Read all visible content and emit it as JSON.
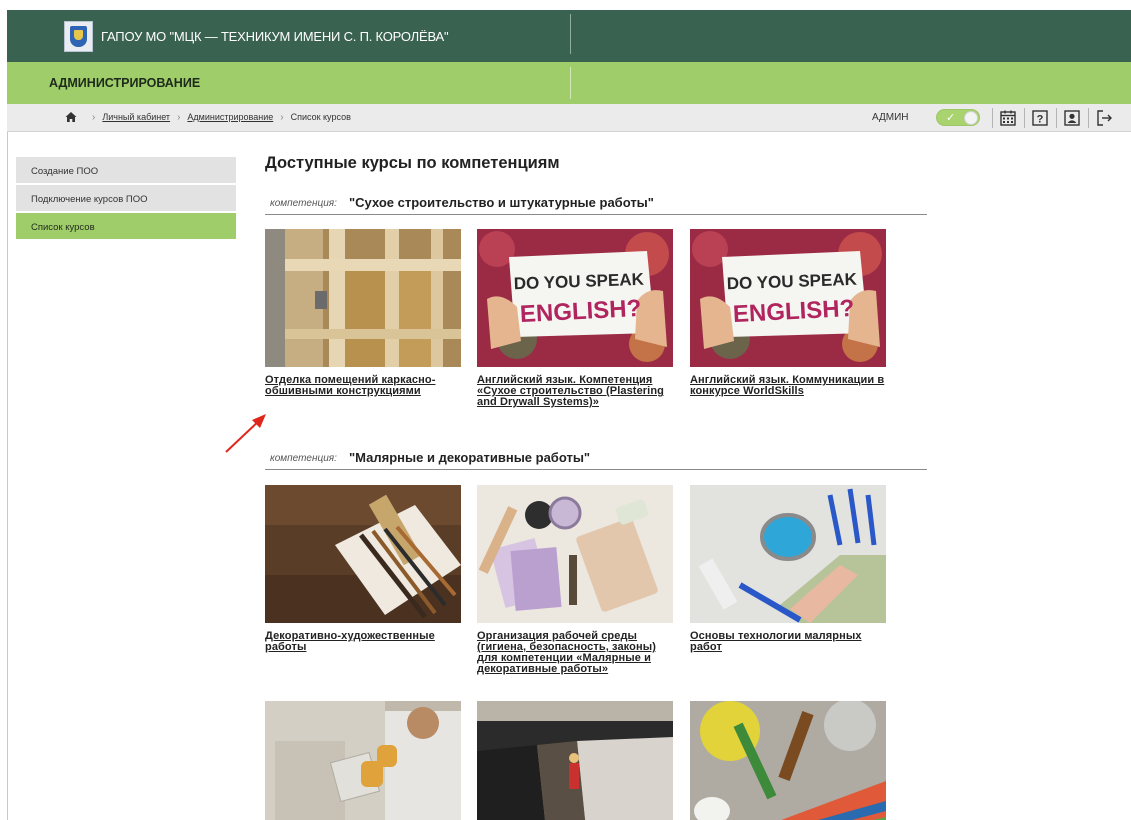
{
  "header": {
    "org_title": "ГАПОУ МО \"МЦК — ТЕХНИКУМ ИМЕНИ С. П. КОРОЛЁВА\"",
    "section_title": "АДМИНИСТРИРОВАНИЕ",
    "logo_icon": "college-emblem-icon"
  },
  "breadcrumb": {
    "home_icon": "home-icon",
    "items": [
      "Личный кабинет",
      "Администрирование",
      "Список курсов"
    ]
  },
  "toolbar": {
    "admin_label": "АДМИН",
    "admin_toggle": "on",
    "check_glyph": "✓",
    "icons": [
      "calendar-icon",
      "help-icon",
      "profile-icon",
      "logout-icon"
    ],
    "help_glyph": "?",
    "logout_glyph": "⇥"
  },
  "sidebar": {
    "items": [
      {
        "label": "Создание ПОО",
        "active": false
      },
      {
        "label": "Подключение курсов ПОО",
        "active": false
      },
      {
        "label": "Список курсов",
        "active": true
      }
    ]
  },
  "main": {
    "page_title": "Доступные курсы по компетенциям",
    "competency_prefix": "компетенция:",
    "competencies": [
      {
        "name": "\"Сухое строительство и штукатурные работы\"",
        "courses": [
          {
            "title": "Отделка помещений каркасно-обшивными конструкциями",
            "image": "wooden-frame-construction-photo"
          },
          {
            "title": "Английский язык. Компетенция «Сухое строительство (Plastering and Drywall Systems)»",
            "image": "do-you-speak-english-sign-photo",
            "image_text_1": "DO YOU SPEAK",
            "image_text_2": "ENGLISH?"
          },
          {
            "title": "Английский язык. Коммуникации в конкурсе WorldSkills",
            "image": "do-you-speak-english-sign-photo",
            "image_text_1": "DO YOU SPEAK",
            "image_text_2": "ENGLISH?"
          }
        ]
      },
      {
        "name": "\"Малярные и декоративные работы\"",
        "courses": [
          {
            "title": "Декоративно-художественные работы",
            "image": "paint-brushes-on-wood-photo"
          },
          {
            "title": "Организация рабочей среды (гигиена, безопасность, законы) для компетенции «Малярные и декоративные работы»",
            "image": "paint-tray-and-swatches-photo"
          },
          {
            "title": "Основы технологии малярных работ",
            "image": "paint-cans-and-roller-photo"
          },
          {
            "title": "",
            "image": "tile-plastering-worker-photo"
          },
          {
            "title": "",
            "image": "foundation-waterproofing-photo"
          },
          {
            "title": "",
            "image": "paint-tools-and-palette-photo"
          }
        ]
      }
    ]
  },
  "annotation": {
    "arrow_color": "#e0251b"
  }
}
